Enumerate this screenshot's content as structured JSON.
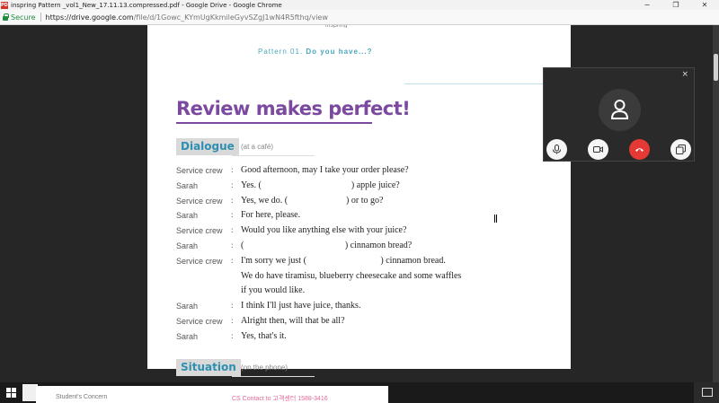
{
  "window": {
    "title": "inspring Pattern _vol1_New_17.11.13.compressed.pdf - Google Drive - Google Chrome",
    "pdf_badge": "PDF",
    "minimize": "−",
    "restore": "❐",
    "close": "✕"
  },
  "address_bar": {
    "secure_label": "Secure",
    "url_host": "https://drive.google.com",
    "url_path": "/file/d/1Gowc_KYmUgKkmileGyvSZgJ1wN4R5fthq/view"
  },
  "prev_page": {
    "text": "inspring"
  },
  "page": {
    "pattern_label": "Pattern 01.",
    "pattern_title": "Do you have...?",
    "review_title": "Review makes perfect!",
    "dialogue": {
      "label": "Dialogue",
      "context": "(at a café)",
      "lines": [
        {
          "speaker": "Service crew",
          "text": "Good afternoon, may I take your order please?"
        },
        {
          "speaker": "Sarah",
          "text": "Yes. (                                        ) apple juice?"
        },
        {
          "speaker": "Service crew",
          "text": "Yes, we do. (                          ) or to go?"
        },
        {
          "speaker": "Sarah",
          "text": "For here, please."
        },
        {
          "speaker": "Service crew",
          "text": "Would you like anything else with your juice?"
        },
        {
          "speaker": "Sarah",
          "text": "(                                             ) cinnamon bread?"
        },
        {
          "speaker": "Service crew",
          "text": "I'm sorry we just (                                 ) cinnamon bread."
        },
        {
          "speaker": "",
          "text": "We do have tiramisu, blueberry cheesecake and some waffles"
        },
        {
          "speaker": "",
          "text": "if you would like."
        },
        {
          "speaker": "Sarah",
          "text": "I think I'll just have juice, thanks."
        },
        {
          "speaker": "Service crew",
          "text": "Alright then, will that be all?"
        },
        {
          "speaker": "Sarah",
          "text": "Yes, that's it."
        }
      ]
    },
    "situation": {
      "label": "Situation",
      "context": "(on the phone)"
    }
  },
  "call_overlay": {
    "close": "×",
    "buttons": [
      "mic-icon",
      "camera-icon",
      "hangup-icon",
      "screen-share-icon"
    ],
    "hangup_color": "#e53935"
  },
  "bottom_strip": {
    "left_text": "Student's Concern",
    "right_text": "CS Contact to 고객센터 1588-3416"
  },
  "colors": {
    "accent_purple": "#7b4aa0",
    "accent_teal": "#2f8fb0",
    "secure_green": "#1e8e3e"
  }
}
